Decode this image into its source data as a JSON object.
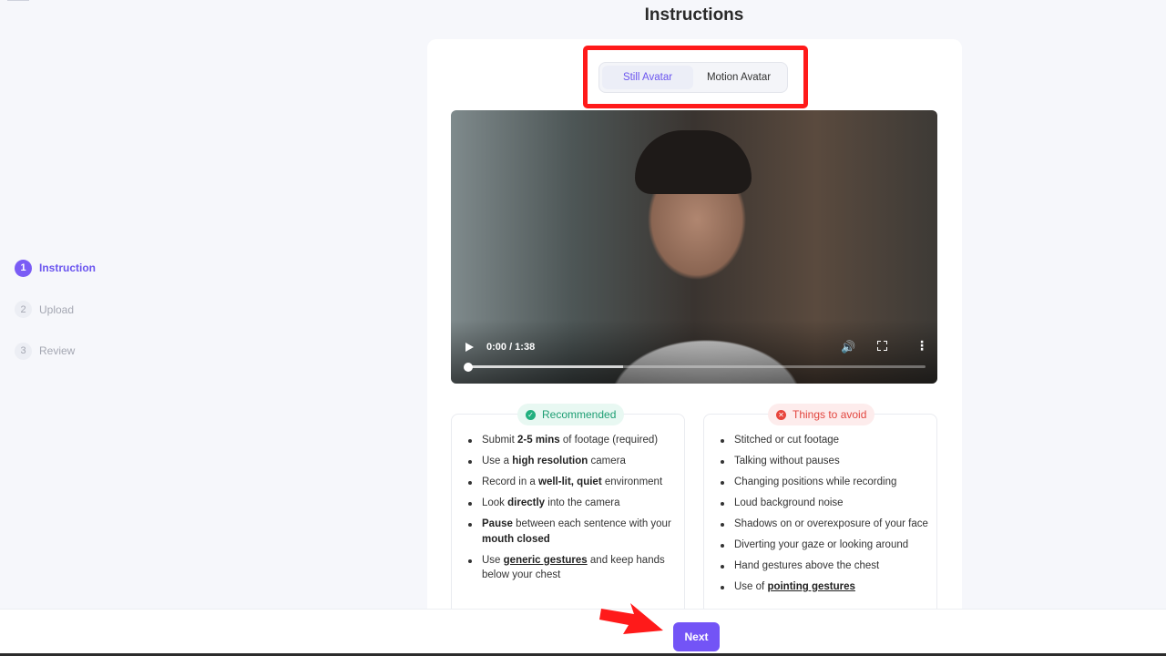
{
  "page": {
    "title": "Instructions"
  },
  "steps": [
    {
      "num": "1",
      "label": "Instruction",
      "active": true
    },
    {
      "num": "2",
      "label": "Upload",
      "active": false
    },
    {
      "num": "3",
      "label": "Review",
      "active": false
    }
  ],
  "tabs": {
    "still": "Still Avatar",
    "motion": "Motion Avatar",
    "selected": "Still Avatar"
  },
  "video": {
    "time": "0:00 / 1:38",
    "played_fraction": 0.0,
    "buffered_fraction": 0.34
  },
  "recommended": {
    "label": "Recommended",
    "items": [
      {
        "pre": "Submit ",
        "bold": "2-5 mins",
        "post": " of footage (required)"
      },
      {
        "pre": "Use a ",
        "bold": "high resolution",
        "post": " camera"
      },
      {
        "pre": "Record in a ",
        "bold": "well-lit, quiet",
        "post": " environment"
      },
      {
        "pre": "Look ",
        "bold": "directly",
        "post": " into the camera"
      },
      {
        "pre": "",
        "bold": "Pause",
        "post": " between each sentence with your ",
        "bold2": "mouth closed"
      },
      {
        "pre": "Use ",
        "link": "generic gestures",
        "post": " and keep hands below your chest"
      }
    ]
  },
  "avoid": {
    "label": "Things to avoid",
    "items": [
      {
        "pre": "Stitched or cut footage"
      },
      {
        "pre": "Talking without pauses"
      },
      {
        "pre": "Changing positions while recording"
      },
      {
        "pre": "Loud background noise"
      },
      {
        "pre": "Shadows on or overexposure of your face"
      },
      {
        "pre": "Diverting your gaze or looking around"
      },
      {
        "pre": "Hand gestures above the chest"
      },
      {
        "pre": "Use of ",
        "link": "pointing gestures"
      }
    ]
  },
  "footer": {
    "next": "Next"
  },
  "colors": {
    "accent": "#7354f6",
    "highlight": "#ff1a1a",
    "success": "#22b07f",
    "danger": "#e8453c"
  }
}
